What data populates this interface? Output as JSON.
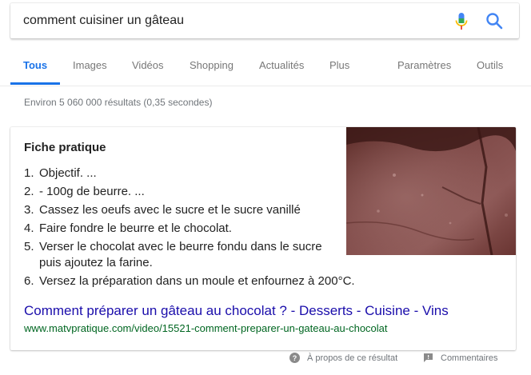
{
  "search": {
    "query": "comment cuisiner un gâteau"
  },
  "tabs": [
    {
      "label": "Tous",
      "active": true
    },
    {
      "label": "Images"
    },
    {
      "label": "Vidéos"
    },
    {
      "label": "Shopping"
    },
    {
      "label": "Actualités"
    },
    {
      "label": "Plus"
    },
    {
      "label": "Paramètres"
    },
    {
      "label": "Outils"
    }
  ],
  "result_stats": "Environ 5 060 000 résultats (0,35 secondes)",
  "featured": {
    "title": "Fiche pratique",
    "steps": [
      {
        "num": "1.",
        "text": "Objectif. ..."
      },
      {
        "num": "2.",
        "text": "- 100g de beurre. ..."
      },
      {
        "num": "3.",
        "text": "Cassez les oeufs avec le sucre et le sucre vanillé"
      },
      {
        "num": "4.",
        "text": "Faire fondre le beurre et le chocolat."
      },
      {
        "num": "5.",
        "text": "Verser le chocolat avec le beurre fondu dans le sucre puis ajoutez la farine."
      },
      {
        "num": "6.",
        "text": "Versez la préparation dans un moule et enfournez à 200°C."
      }
    ],
    "link_title": "Comment préparer un gâteau au chocolat ? - Desserts - Cuisine - Vins",
    "link_url": "www.matvpratique.com/video/15521-comment-preparer-un-gateau-au-chocolat",
    "image_icon": "brownie-cake-photo"
  },
  "footer": {
    "about": "À propos de ce résultat",
    "feedback": "Commentaires"
  },
  "colors": {
    "accent": "#1a73e8",
    "link": "#1a0dab",
    "url": "#006621"
  }
}
